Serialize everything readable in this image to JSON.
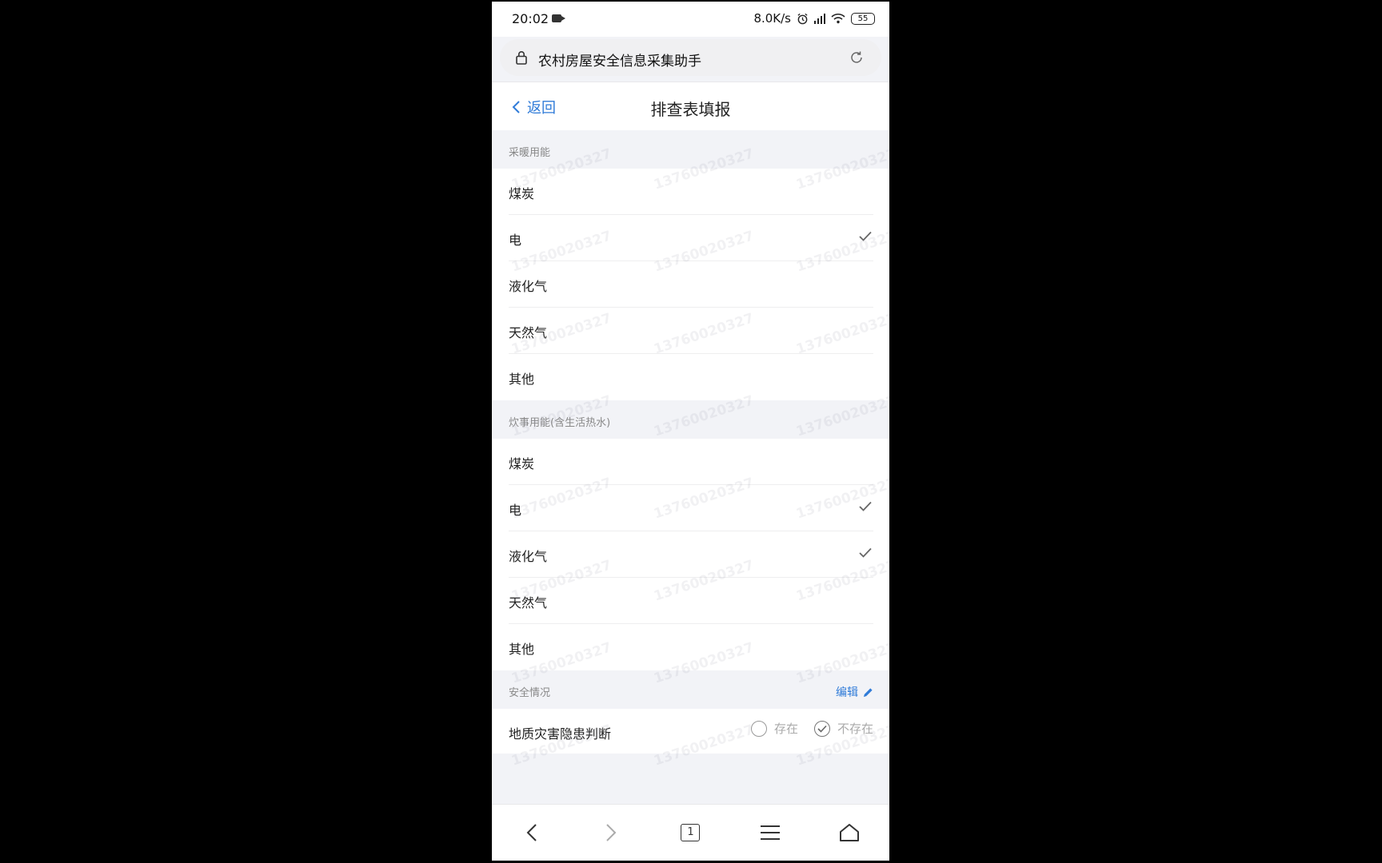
{
  "status_bar": {
    "time": "20:02",
    "speed": "8.0K/s",
    "battery": "55"
  },
  "url_bar": {
    "title": "农村房屋安全信息采集助手"
  },
  "header": {
    "back_label": "返回",
    "title": "排查表填报"
  },
  "heating": {
    "title": "采暖用能",
    "options": [
      {
        "label": "煤炭",
        "checked": false
      },
      {
        "label": "电",
        "checked": true
      },
      {
        "label": "液化气",
        "checked": false
      },
      {
        "label": "天然气",
        "checked": false
      },
      {
        "label": "其他",
        "checked": false
      }
    ]
  },
  "cooking": {
    "title": "炊事用能(含生活热水)",
    "options": [
      {
        "label": "煤炭",
        "checked": false
      },
      {
        "label": "电",
        "checked": true
      },
      {
        "label": "液化气",
        "checked": true
      },
      {
        "label": "天然气",
        "checked": false
      },
      {
        "label": "其他",
        "checked": false
      }
    ]
  },
  "safety": {
    "title": "安全情况",
    "edit_label": "编辑",
    "geo_hazard": {
      "label": "地质灾害隐患判断",
      "option_exists": "存在",
      "option_not_exists": "不存在",
      "selected": "不存在"
    }
  },
  "bottom_nav": {
    "tab_count": "1"
  },
  "watermark": "13760020327",
  "colors": {
    "accent": "#2f7bd8",
    "check": "#666666",
    "background": "#f2f3f7"
  }
}
